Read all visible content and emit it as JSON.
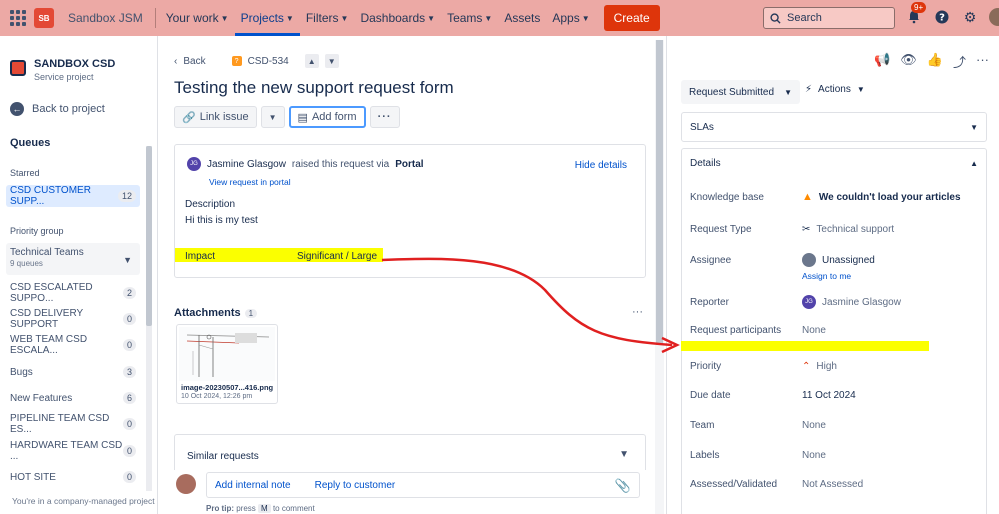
{
  "topbar": {
    "site": "Sandbox JSM",
    "nav": [
      "Your work",
      "Projects",
      "Filters",
      "Dashboards",
      "Teams",
      "Assets",
      "Apps"
    ],
    "create": "Create",
    "search_placeholder": "Search",
    "notif_badge": "9+",
    "logo_text": "SB"
  },
  "sidebar": {
    "project_name": "SANDBOX CSD",
    "project_type": "Service project",
    "back": "Back to project",
    "queues": "Queues",
    "starred": "Starred",
    "starred_item": {
      "label": "CSD CUSTOMER SUPP...",
      "count": "12"
    },
    "priority_group": "Priority group",
    "group": {
      "title": "Technical Teams",
      "sub": "9 queues"
    },
    "items": [
      {
        "label": "CSD ESCALATED SUPPO...",
        "count": "2"
      },
      {
        "label": "CSD DELIVERY SUPPORT",
        "count": "0"
      },
      {
        "label": "WEB TEAM CSD ESCALA...",
        "count": "0"
      },
      {
        "label": "Bugs",
        "count": "3"
      },
      {
        "label": "New Features",
        "count": "6"
      },
      {
        "label": "PIPELINE TEAM CSD ES...",
        "count": "0"
      },
      {
        "label": "HARDWARE TEAM CSD ...",
        "count": "0"
      },
      {
        "label": "HOT SITE",
        "count": "0"
      }
    ],
    "footer": "You're in a company-managed project"
  },
  "main": {
    "back": "Back",
    "ticket_key": "CSD-534",
    "title": "Testing the new support request form",
    "link_issue": "Link issue",
    "add_form": "Add form",
    "requester": "Jasmine Glasgow",
    "requester_initials": "JG",
    "raised_text": "raised this request via",
    "channel": "Portal",
    "view_portal": "View request in portal",
    "hide_details": "Hide details",
    "description_label": "Description",
    "description_text": "Hi this is my test",
    "impact_label": "Impact",
    "impact_value": "Significant / Large",
    "attachments_label": "Attachments",
    "attachments_count": "1",
    "attachment_name": "image-20230507...416.png",
    "attachment_date": "10 Oct 2024, 12:26 pm",
    "similar": "Similar requests",
    "add_internal_note": "Add internal note",
    "reply_customer": "Reply to customer",
    "pro_tip_a": "Pro tip:",
    "pro_tip_b": "press",
    "pro_tip_key": "M",
    "pro_tip_c": "to comment"
  },
  "right": {
    "status": "Request Submitted",
    "actions": "Actions",
    "slas": "SLAs",
    "details": "Details",
    "rows": {
      "kb_label": "Knowledge base",
      "kb_value": "We couldn't load your articles",
      "type_label": "Request Type",
      "type_value": "Technical support",
      "assignee_label": "Assignee",
      "assignee_value": "Unassigned",
      "assign_me": "Assign to me",
      "reporter_label": "Reporter",
      "reporter_value": "Jasmine Glasgow",
      "reporter_initials": "JG",
      "participants_label": "Request participants",
      "participants_value": "None",
      "priority_label": "Priority",
      "priority_value": "High",
      "due_label": "Due date",
      "due_value": "11 Oct 2024",
      "team_label": "Team",
      "team_value": "None",
      "labels_label": "Labels",
      "labels_value": "None",
      "assessed_label": "Assessed/Validated",
      "assessed_value": "Not Assessed"
    }
  },
  "colors": {
    "topbar": "#eca9a5",
    "accent": "#0052cc",
    "create": "#de350b",
    "highlight": "#fbff00",
    "annotation": "#e02020"
  }
}
